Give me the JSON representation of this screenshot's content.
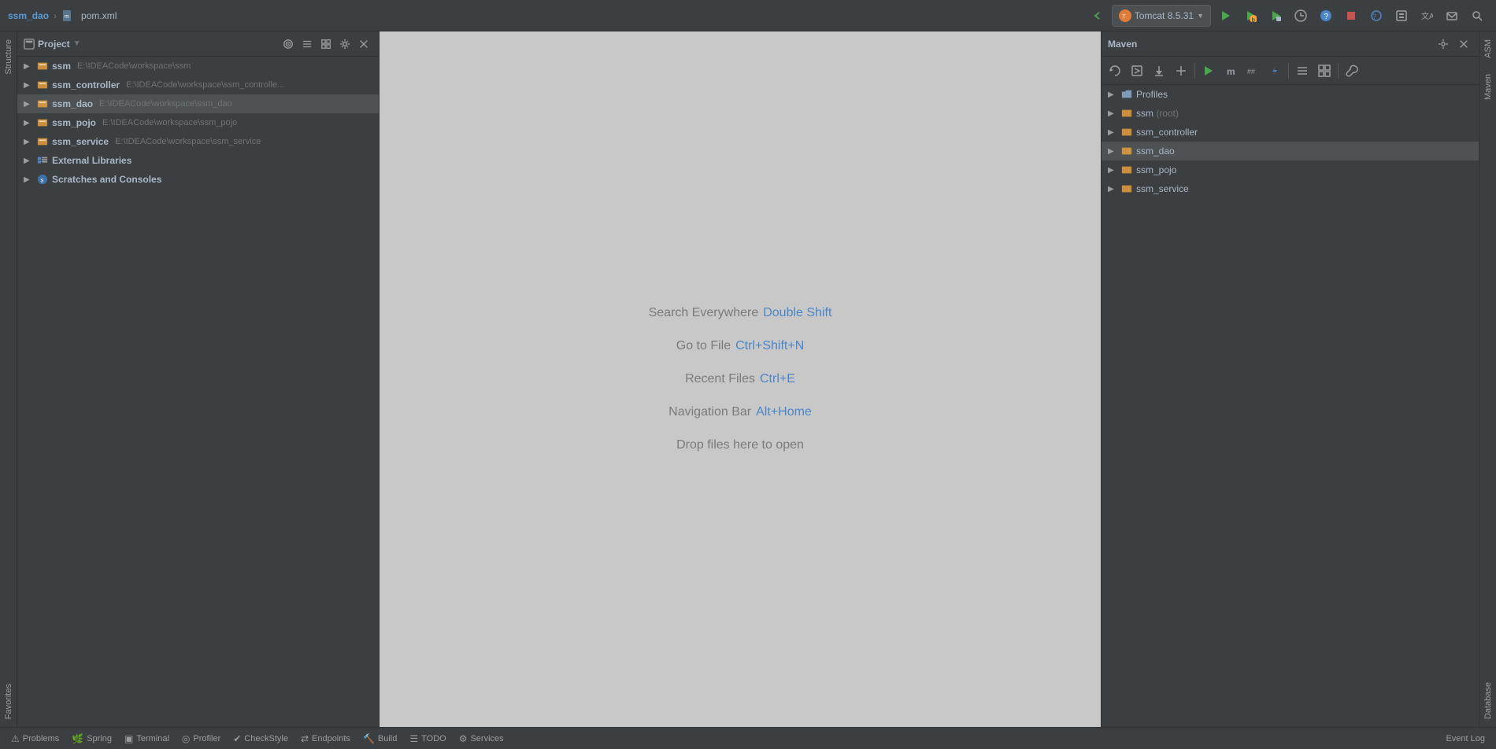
{
  "titleBar": {
    "breadcrumb1": "ssm_dao",
    "separator": "›",
    "breadcrumb2": "pom.xml"
  },
  "toolbar": {
    "tomcat": "Tomcat 8.5.31",
    "buttons": [
      "⬅",
      "🔨",
      "⬇",
      "⏱",
      "❓",
      "⏹",
      "🌐",
      "⬜",
      "🔤",
      "✉",
      "🔍"
    ]
  },
  "projectPanel": {
    "title": "Project",
    "items": [
      {
        "name": "ssm",
        "path": "E:\\IDEACode\\workspace\\ssm",
        "type": "module",
        "level": 0,
        "expanded": false
      },
      {
        "name": "ssm_controller",
        "path": "E:\\IDEACode\\workspace\\ssm_controlle...",
        "type": "module",
        "level": 0,
        "expanded": false
      },
      {
        "name": "ssm_dao",
        "path": "E:\\IDEACode\\workspace\\ssm_dao",
        "type": "module",
        "level": 0,
        "selected": true,
        "expanded": false
      },
      {
        "name": "ssm_pojo",
        "path": "E:\\IDEACode\\workspace\\ssm_pojo",
        "type": "module",
        "level": 0,
        "expanded": false
      },
      {
        "name": "ssm_service",
        "path": "E:\\IDEACode\\workspace\\ssm_service",
        "type": "module",
        "level": 0,
        "expanded": false
      },
      {
        "name": "External Libraries",
        "path": "",
        "type": "external",
        "level": 0,
        "expanded": false
      },
      {
        "name": "Scratches and Consoles",
        "path": "",
        "type": "scratches",
        "level": 0,
        "expanded": false
      }
    ]
  },
  "editor": {
    "hints": [
      {
        "label": "Search Everywhere",
        "key": "Double Shift"
      },
      {
        "label": "Go to File",
        "key": "Ctrl+Shift+N"
      },
      {
        "label": "Recent Files",
        "key": "Ctrl+E"
      },
      {
        "label": "Navigation Bar",
        "key": "Alt+Home"
      },
      {
        "label": "Drop files here to open",
        "key": ""
      }
    ]
  },
  "mavenPanel": {
    "title": "Maven",
    "items": [
      {
        "name": "Profiles",
        "type": "folder",
        "level": 0,
        "expanded": false,
        "arrow": "▶"
      },
      {
        "name": "ssm",
        "extra": "(root)",
        "type": "module",
        "level": 0,
        "expanded": false,
        "arrow": "▶"
      },
      {
        "name": "ssm_controller",
        "extra": "",
        "type": "module",
        "level": 0,
        "expanded": false,
        "arrow": "▶"
      },
      {
        "name": "ssm_dao",
        "extra": "",
        "type": "module",
        "level": 0,
        "selected": true,
        "expanded": false,
        "arrow": "▶"
      },
      {
        "name": "ssm_pojo",
        "extra": "",
        "type": "module",
        "level": 0,
        "expanded": false,
        "arrow": "▶"
      },
      {
        "name": "ssm_service",
        "extra": "",
        "type": "module",
        "level": 0,
        "expanded": false,
        "arrow": "▶"
      }
    ]
  },
  "statusBar": {
    "items": [
      {
        "icon": "⚠",
        "label": "Problems"
      },
      {
        "icon": "🌿",
        "label": "Spring"
      },
      {
        "icon": "▣",
        "label": "Terminal"
      },
      {
        "icon": "◎",
        "label": "Profiler"
      },
      {
        "icon": "✔",
        "label": "CheckStyle"
      },
      {
        "icon": "⇄",
        "label": "Endpoints"
      },
      {
        "icon": "🔨",
        "label": "Build"
      },
      {
        "icon": "☰",
        "label": "TODO"
      },
      {
        "icon": "⚙",
        "label": "Services"
      }
    ],
    "rightItems": [
      {
        "label": "Event Log"
      }
    ]
  },
  "rightSideTabs": [
    "ASM",
    "Maven",
    "Database"
  ],
  "leftSideTabs": [
    "Structure",
    "Favorites"
  ]
}
